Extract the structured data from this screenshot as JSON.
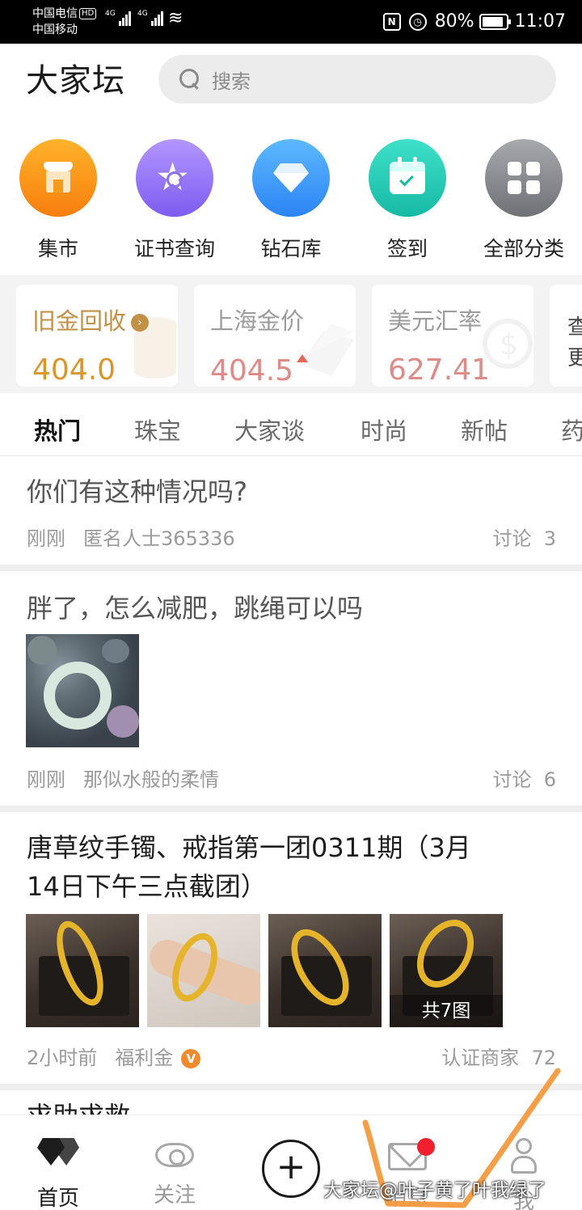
{
  "status_bar": {
    "carrier1": "中国电信",
    "hd": "HD",
    "carrier2": "中国移动",
    "net1": "4G",
    "net2": "4G",
    "nfc": "N",
    "alarm": "◷",
    "battery": "80%",
    "time": "11:07"
  },
  "header": {
    "logo": "大家坛",
    "search_placeholder": "搜索"
  },
  "categories": [
    {
      "label": "集市",
      "icon": "shop-icon",
      "color": "#f77e0d"
    },
    {
      "label": "证书查询",
      "icon": "certificate-icon",
      "color": "#7e5cf0"
    },
    {
      "label": "钻石库",
      "icon": "diamond-icon",
      "color": "#2c84f3"
    },
    {
      "label": "签到",
      "icon": "calendar-check-icon",
      "color": "#16b9a4"
    },
    {
      "label": "全部分类",
      "icon": "grid-icon",
      "color": "#6f7177"
    }
  ],
  "prices": [
    {
      "title": "旧金回收",
      "value": "404.0"
    },
    {
      "title": "上海金价",
      "value": "404.5"
    },
    {
      "title": "美元汇率",
      "value": "627.41"
    },
    {
      "title": "查",
      "title2": "更"
    }
  ],
  "tabs": [
    "热门",
    "珠宝",
    "大家谈",
    "时尚",
    "新帖",
    "药"
  ],
  "posts": [
    {
      "title": "你们有这种情况吗?",
      "time": "刚刚",
      "author": "匿名人士365336",
      "count_label": "讨论",
      "count": "3"
    },
    {
      "title": "胖了，怎么减肥，跳绳可以吗",
      "time": "刚刚",
      "author": "那似水般的柔情",
      "count_label": "讨论",
      "count": "6"
    },
    {
      "title_line1": "唐草纹手镯、戒指第一团0311期（3月",
      "title_line2": "14日下午三点截团）",
      "time": "2小时前",
      "author": "福利金",
      "badge": "V",
      "count_label": "认证商家",
      "count": "72",
      "image_count": "共7图"
    },
    {
      "title": "求助求救"
    }
  ],
  "bottom_nav": {
    "home": "首页",
    "follow": "关注",
    "plus": "+",
    "messages": "消息",
    "me": "我"
  },
  "watermark": "大家坛@叶子黄了叶我绿了",
  "colors": {
    "accent_gold": "#c29146",
    "price_red": "#de8a86",
    "badge_orange": "#f18a2c",
    "notify_red": "#f0202f",
    "annotation_orange": "#f39a3d"
  }
}
